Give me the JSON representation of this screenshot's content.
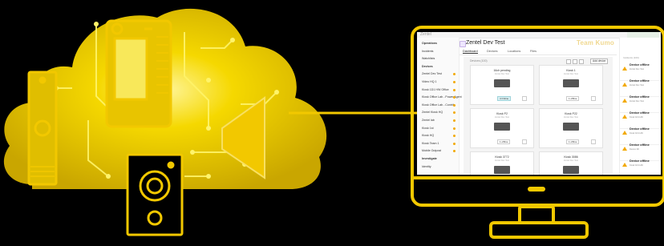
{
  "colors": {
    "accent": "#f2c800",
    "background": "#000000",
    "warning": "#f2a900"
  },
  "app": {
    "topbar_text": "Zentel",
    "title": "Zentel Dev Test",
    "overlay_title": "Team Kumo",
    "tabs": [
      "Dashboard",
      "Devices",
      "Locations",
      "Files"
    ],
    "sidebar": [
      {
        "label": "Operations",
        "group": true,
        "icon": "gear-icon"
      },
      {
        "label": "Incidents",
        "group": false
      },
      {
        "label": "Watchlists",
        "group": false
      },
      {
        "label": "Devices",
        "group": true,
        "icon": "share-icon"
      },
      {
        "label": "Zentel Dev Test",
        "group": false
      },
      {
        "label": "Video HQ 1",
        "group": false
      },
      {
        "label": "Kiosk 1D1 HW Office",
        "group": false
      },
      {
        "label": "Kiosk Office Lab - Power Agent",
        "group": false
      },
      {
        "label": "Kiosk Office Lab - Contrib",
        "group": false
      },
      {
        "label": "Zentel Kiosk HQ",
        "group": false
      },
      {
        "label": "Zentel lab",
        "group": false
      },
      {
        "label": "Kiosk 1st",
        "group": false
      },
      {
        "label": "Kiosk HQ",
        "group": false
      },
      {
        "label": "Kiosk Team 1",
        "group": false
      },
      {
        "label": "Mobile Outpost",
        "group": false
      },
      {
        "label": "Investigate",
        "group": true,
        "icon": "search-icon"
      },
      {
        "label": "Identity",
        "group": false
      }
    ],
    "panel_heading": "Devices (100)",
    "add_button": "Add device",
    "cards": [
      {
        "name": "16ch pending",
        "sub": "Zentel Dev Test",
        "status": "4 Online",
        "online": true
      },
      {
        "name": "Kiosk 1",
        "sub": "Zentel Dev Test",
        "status": "1 offline",
        "online": false
      },
      {
        "name": "Kiosk P2",
        "sub": "Zentel Dev Test",
        "status": "1 offline",
        "online": false
      },
      {
        "name": "Kiosk P22",
        "sub": "Zentel Dev Test",
        "status": "1 offline",
        "online": false
      },
      {
        "name": "Kiosk 3772",
        "sub": "Zentel Dev Test",
        "status": "1 offline",
        "online": false
      },
      {
        "name": "Kiosk 3086",
        "sub": "Zentel Dev Test",
        "status": "1 offline",
        "online": false
      }
    ],
    "alerts_heading": "Incidents (100)",
    "alerts": [
      {
        "title": "Device offline",
        "detail": "Zentel Dev Test"
      },
      {
        "title": "Device offline",
        "detail": "Zentel Dev Test"
      },
      {
        "title": "Device offline",
        "detail": "Zentel Dev Test"
      },
      {
        "title": "Device offline",
        "detail": "Kiosk 1D1 HW"
      },
      {
        "title": "Device offline",
        "detail": "Kiosk 1D1 HW"
      },
      {
        "title": "Device offline",
        "detail": "Device 3D"
      },
      {
        "title": "Device offline",
        "detail": "Kiosk 1D1 HW"
      }
    ]
  }
}
